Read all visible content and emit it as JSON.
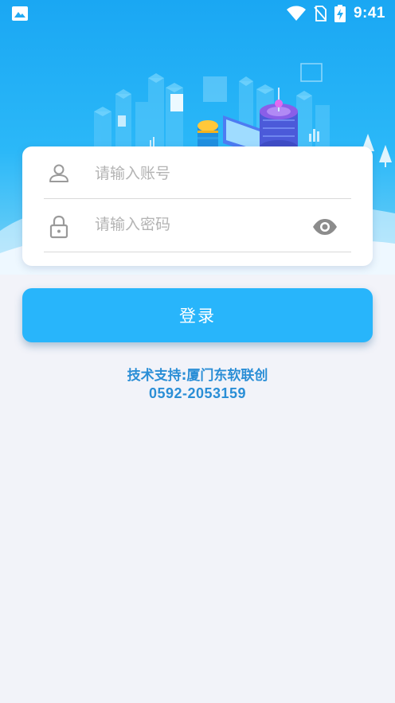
{
  "status_bar": {
    "time": "9:41",
    "icons": [
      "image-icon",
      "wifi-icon",
      "no-sim-icon",
      "battery-charging-icon"
    ]
  },
  "login": {
    "account_placeholder": "请输入账号",
    "password_placeholder": "请输入密码",
    "account_icon": "user-icon",
    "password_icon": "lock-icon",
    "toggle_icon": "eye-icon",
    "submit_label": "登录"
  },
  "support": {
    "label": "技术支持:厦门东软联创",
    "phone": "0592-2053159"
  },
  "colors": {
    "primary": "#28b5fb",
    "support_text": "#2a8ed6",
    "background": "#f2f3f9"
  }
}
